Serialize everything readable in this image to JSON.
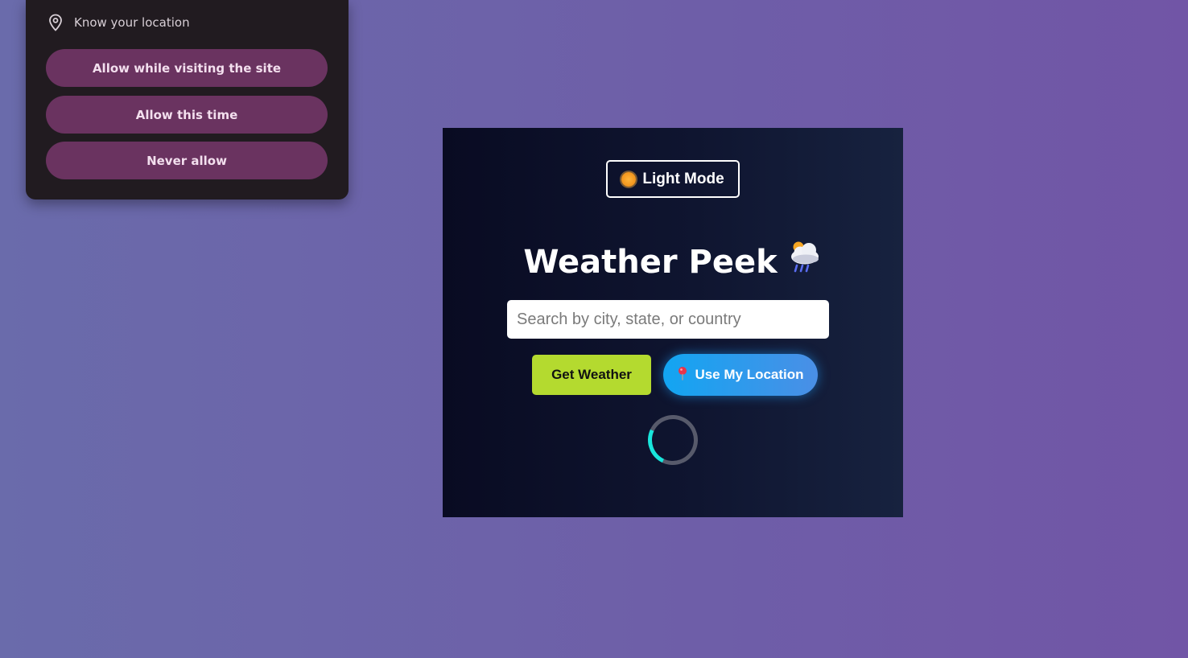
{
  "permission_popup": {
    "prompt": "Know your location",
    "prompt_icon": "location-pin-icon",
    "buttons": [
      {
        "label": "Allow while visiting the site"
      },
      {
        "label": "Allow this time"
      },
      {
        "label": "Never allow"
      }
    ]
  },
  "weather_app": {
    "mode_toggle": {
      "icon": "sun-icon",
      "label": "Light Mode"
    },
    "title": "Weather Peek",
    "title_icon": "cloud-rain-sun-icon",
    "search": {
      "placeholder": "Search by city, state, or country",
      "value": ""
    },
    "get_weather_label": "Get Weather",
    "use_location": {
      "icon": "red-pin-icon",
      "label": "Use My Location"
    },
    "loading": true
  },
  "colors": {
    "background_left": "#6a6bab",
    "background_right": "#7155a6",
    "popup_bg": "#211b20",
    "popup_button": "#6a3360",
    "card_bg_left": "#090b22",
    "card_bg_right": "#17223f",
    "get_weather_button": "#b4da2f",
    "location_button": "#12a5f2",
    "spinner_accent": "#19e6dc"
  }
}
